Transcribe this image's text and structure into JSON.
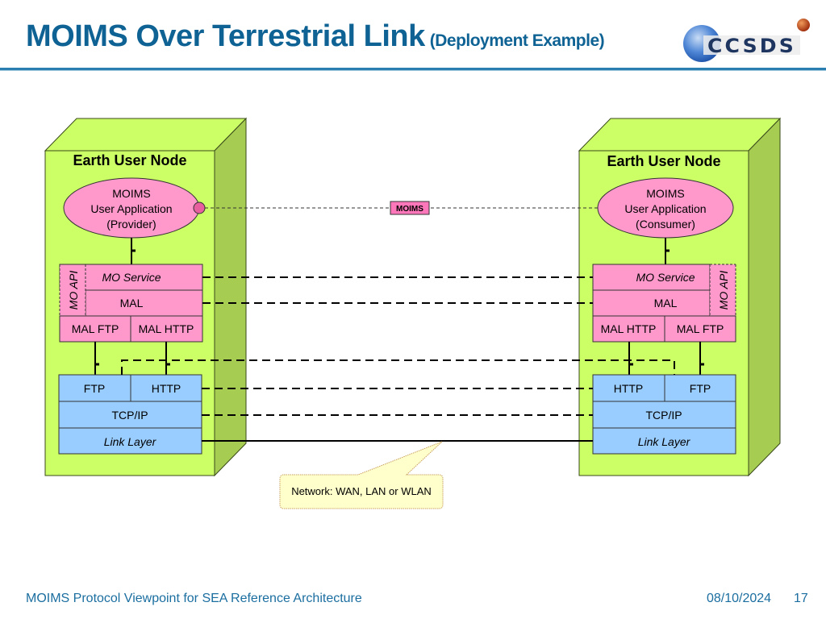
{
  "header": {
    "title": "MOIMS Over Terrestrial Link",
    "subtitle": "(Deployment Example)",
    "logo_text": "CCSDS"
  },
  "colors": {
    "title": "#0f6394",
    "node_front": "#ccff66",
    "node_side": "#a6cc52",
    "mo_layer": "#ff99cc",
    "transport_layer": "#99ccff",
    "callout": "#ffffcc"
  },
  "left_node": {
    "title": "Earth User Node",
    "app": {
      "line1": "MOIMS",
      "line2": "User Application",
      "line3": "(Provider)"
    },
    "mo_api": "MO API",
    "mo_service": "MO Service",
    "mal": "MAL",
    "mal_bindings": [
      "MAL FTP",
      "MAL HTTP"
    ],
    "transports": [
      "FTP",
      "HTTP"
    ],
    "tcpip": "TCP/IP",
    "link_layer": "Link Layer"
  },
  "right_node": {
    "title": "Earth User Node",
    "app": {
      "line1": "MOIMS",
      "line2": "User Application",
      "line3": "(Consumer)"
    },
    "mo_api": "MO API",
    "mo_service": "MO Service",
    "mal": "MAL",
    "mal_bindings": [
      "MAL HTTP",
      "MAL FTP"
    ],
    "transports": [
      "HTTP",
      "FTP"
    ],
    "tcpip": "TCP/IP",
    "link_layer": "Link Layer"
  },
  "interface_label": "MOIMS",
  "network_callout": "Network: WAN, LAN or WLAN",
  "footer": {
    "left": "MOIMS Protocol Viewpoint for SEA Reference Architecture",
    "date": "08/10/2024",
    "page": "17"
  }
}
